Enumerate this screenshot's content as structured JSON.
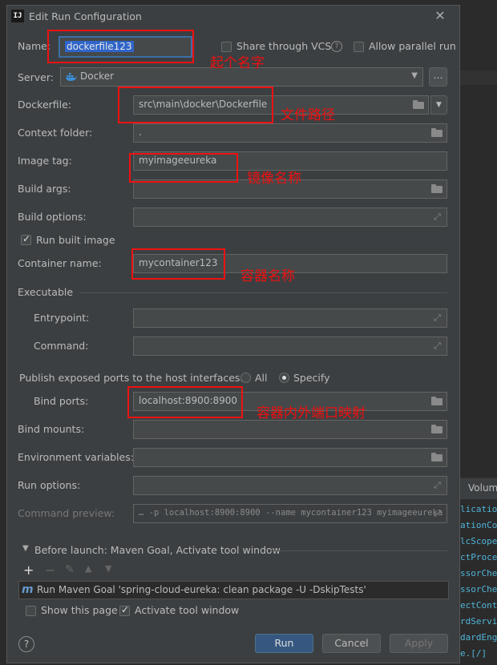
{
  "background": {
    "right_header": "Volum",
    "right_lines": [
      "lication",
      "ationCon",
      "lcScope",
      "ctProces",
      "ssorChec",
      "ssorChec",
      "ectConta",
      "rdServic",
      "dardEng",
      "e.[/]"
    ]
  },
  "dialog": {
    "title": "Edit Run Configuration",
    "name_label": "Name:",
    "name_value": "dockerfile123",
    "share_vcs_label": "Share through VCS",
    "allow_parallel_label": "Allow parallel run",
    "server_label": "Server:",
    "server_value": "Docker",
    "server_more": "...",
    "dockerfile_label": "Dockerfile:",
    "dockerfile_value": "src\\main\\docker\\Dockerfile",
    "context_folder_label": "Context folder:",
    "context_folder_value": ".",
    "image_tag_label": "Image tag:",
    "image_tag_value": "myimageeureka",
    "build_args_label": "Build args:",
    "build_options_label": "Build options:",
    "run_built_image_label": "Run built image",
    "container_name_label": "Container name:",
    "container_name_value": "mycontainer123",
    "executable_label": "Executable",
    "entrypoint_label": "Entrypoint:",
    "command_label": "Command:",
    "publish_ports_label": "Publish exposed ports to the host interfaces:",
    "publish_all_label": "All",
    "publish_specify_label": "Specify",
    "bind_ports_label": "Bind ports:",
    "bind_ports_value": "localhost:8900:8900",
    "bind_mounts_label": "Bind mounts:",
    "env_vars_label": "Environment variables:",
    "run_options_label": "Run options:",
    "command_preview_label": "Command preview:",
    "command_preview_value": "… -p localhost:8900:8900 --name mycontainer123 myimageeureka",
    "before_launch_label": "Before launch: Maven Goal, Activate tool window",
    "task_item": "Run Maven Goal 'spring-cloud-eureka: clean package -U -DskipTests'",
    "show_page_label": "Show this page",
    "activate_tool_label": "Activate tool window",
    "run_button": "Run",
    "cancel_button": "Cancel",
    "apply_button": "Apply"
  },
  "annotations": {
    "name": "起个名字",
    "dockerfile": "文件路径",
    "image": "镜像名称",
    "container": "容器名称",
    "ports": "容器内外端口映射"
  },
  "colors": {
    "annotation": "#ee1111",
    "primary_button": "#365880",
    "dialog_bg": "#3c3f41"
  }
}
